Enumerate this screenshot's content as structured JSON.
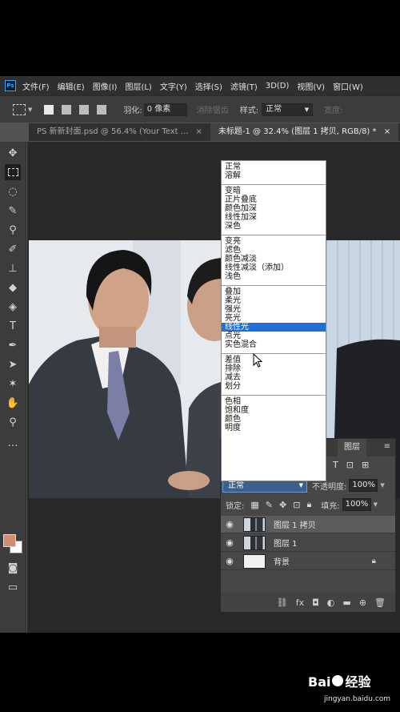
{
  "menu": {
    "logo": "Ps",
    "items": [
      "文件(F)",
      "编辑(E)",
      "图像(I)",
      "图层(L)",
      "文字(Y)",
      "选择(S)",
      "滤镜(T)",
      "3D(D)",
      "视图(V)",
      "窗口(W)"
    ]
  },
  "options": {
    "feather_label": "羽化:",
    "feather_value": "0 像素",
    "antialias_label": "消除锯齿",
    "style_label": "样式:",
    "style_value": "正常",
    "width_label": "宽度:"
  },
  "tabs": [
    {
      "label": "PS 新新封面.psd @ 56.4% (Your Text ...",
      "close": "×"
    },
    {
      "label": "未标题-1 @ 32.4% (图层 1 拷贝, RGB/8) *",
      "close": "×"
    }
  ],
  "blend_modes": {
    "groups": [
      [
        "正常",
        "溶解"
      ],
      [
        "变暗",
        "正片叠底",
        "颜色加深",
        "线性加深",
        "深色"
      ],
      [
        "变亮",
        "滤色",
        "颜色减淡",
        "线性减淡（添加）",
        "浅色"
      ],
      [
        "叠加",
        "柔光",
        "强光",
        "亮光",
        "线性光",
        "点光",
        "实色混合"
      ],
      [
        "差值",
        "排除",
        "减去",
        "划分"
      ],
      [
        "色相",
        "饱和度",
        "颜色",
        "明度"
      ]
    ],
    "highlighted": "线性光"
  },
  "layers_panel": {
    "tab_label": "图层",
    "blend_value": "正常",
    "opacity_label": "不透明度:",
    "opacity_value": "100%",
    "lock_label": "锁定:",
    "fill_label": "填充:",
    "fill_value": "100%",
    "layers": [
      {
        "name": "图层 1 拷贝",
        "selected": true
      },
      {
        "name": "图层 1",
        "selected": false
      },
      {
        "name": "背景",
        "selected": false,
        "locked": true
      }
    ]
  },
  "colors": {
    "foreground": "#d38d6d",
    "background": "#ffffff",
    "highlight": "#1f6fd6"
  },
  "watermark": {
    "brand": "Bai",
    "brand2": "经验",
    "url": "jingyan.baidu.com"
  }
}
